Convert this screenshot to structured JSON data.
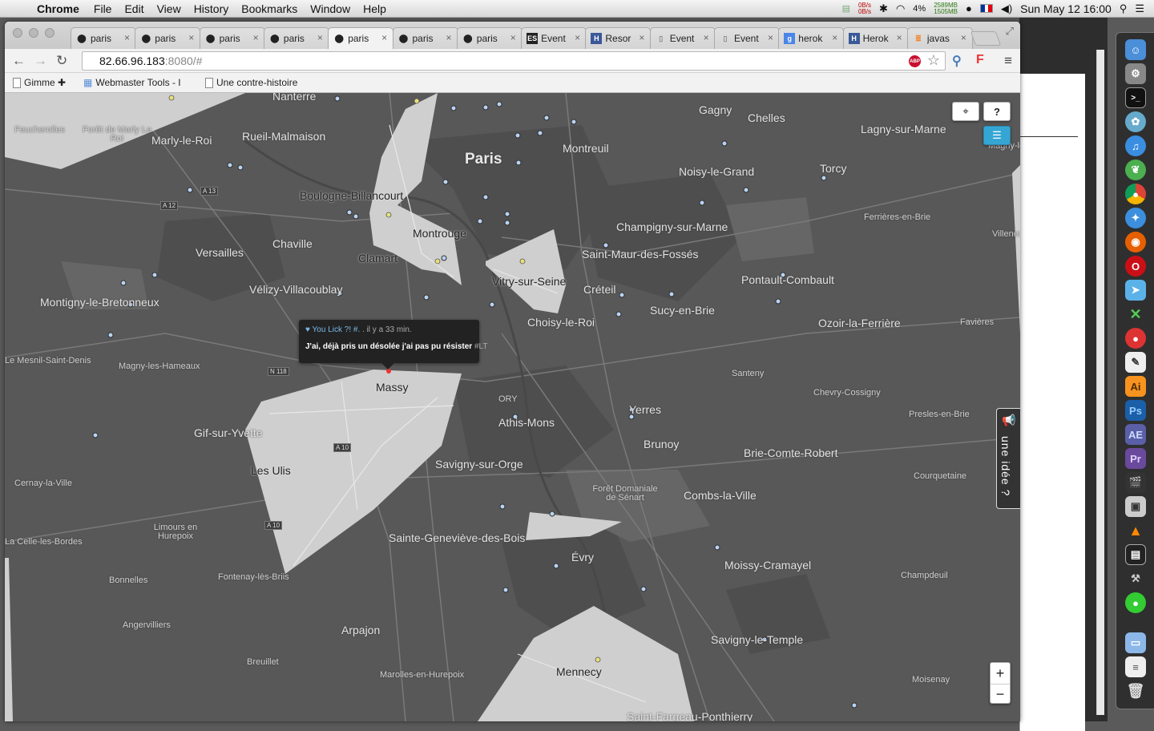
{
  "menubar": {
    "app_name": "Chrome",
    "menus": [
      "File",
      "Edit",
      "View",
      "History",
      "Bookmarks",
      "Window",
      "Help"
    ],
    "net_up": "0B/s",
    "net_down": "0B/s",
    "battery": "4%",
    "mem_used": "2589MB",
    "mem_free": "1505MB",
    "datetime": "Sun May 12  16:00"
  },
  "tabs": [
    {
      "label": "paris",
      "icon": "map-pin-icon"
    },
    {
      "label": "paris",
      "icon": "map-pin-icon"
    },
    {
      "label": "paris",
      "icon": "map-pin-icon"
    },
    {
      "label": "paris",
      "icon": "map-pin-icon"
    },
    {
      "label": "paris",
      "icon": "map-pin-icon",
      "active": true
    },
    {
      "label": "paris",
      "icon": "map-pin-icon"
    },
    {
      "label": "paris",
      "icon": "map-pin-icon"
    },
    {
      "label": "Event",
      "icon": "es-icon"
    },
    {
      "label": "Resor",
      "icon": "h-icon"
    },
    {
      "label": "Event",
      "icon": "page-icon"
    },
    {
      "label": "Event",
      "icon": "page-icon"
    },
    {
      "label": "herok",
      "icon": "google-icon"
    },
    {
      "label": "Herok",
      "icon": "h-icon"
    },
    {
      "label": "javas",
      "icon": "stack-icon"
    }
  ],
  "address": {
    "host": "82.66.96.183",
    "path": ":8080/#"
  },
  "bookmarks": [
    {
      "label": "Gimme ✚"
    },
    {
      "label": "Webmaster Tools - I"
    },
    {
      "label": "Une contre-histoire"
    }
  ],
  "map": {
    "places_big": [
      {
        "name": "Paris"
      }
    ],
    "places": [
      "Nanterre",
      "Rueil-Malmaison",
      "Marly-le-Roi",
      "Boulogne-Billancourt",
      "Montrouge",
      "Clamart",
      "Chaville",
      "Versailles",
      "Vélizy-Villacoublay",
      "Montigny-le-Bretonneux",
      "Vitry-sur-Seine",
      "Créteil",
      "Choisy-le-Roi",
      "Saint-Maur-des-Fossés",
      "Champigny-sur-Marne",
      "Noisy-le-Grand",
      "Montreuil",
      "Gagny",
      "Chelles",
      "Lagny-sur-Marne",
      "Torcy",
      "Pontault-Combault",
      "Sucy-en-Brie",
      "Ozoir-la-Ferrière",
      "Massy",
      "Athis-Mons",
      "Yerres",
      "Brunoy",
      "Brie-Comte-Robert",
      "Gif-sur-Yvette",
      "Les Ulis",
      "Savigny-sur-Orge",
      "Combs-la-Ville",
      "Sainte-Geneviève-des-Bois",
      "Évry",
      "Moissy-Cramayel",
      "Arpajon",
      "Mennecy",
      "Savigny-le-Temple",
      "Saint-Fargeau-Ponthierry"
    ],
    "places_small": [
      "Feucherolles",
      "Forêt de Marly Le Roi",
      "Magny-les-Hameaux",
      "Le Mesnil-Saint-Denis",
      "Cernay-la-Ville",
      "Limours en Hurepoix",
      "Bonnelles",
      "Fontenay-lès-Briis",
      "Angervilliers",
      "Breuillet",
      "Marolles-en-Hurepoix",
      "Santeny",
      "Chevry-Cossigny",
      "Presles-en-Brie",
      "Courquetaine",
      "Forêt Domaniale de Sénart",
      "Champdeuil",
      "Moisenay",
      "Favières",
      "Ferrières-en-Brie",
      "ORY",
      "La Celle-les-Bordes",
      "Magny-le-Hongre",
      "Villeneuve"
    ],
    "roads": [
      "A 13",
      "A 12",
      "N 118",
      "A 10",
      "A 10"
    ],
    "popup": {
      "author": "You Lick ?! #.",
      "time": ". il y a 33 min.",
      "message": "J'ai, déjà pris un désolée j'ai pas pu résister ",
      "tag": "#LT"
    },
    "idea_label": "une idée ?",
    "zoom_in": "+",
    "zoom_out": "−"
  },
  "colors": {
    "map_bg": "#585858",
    "zone_fill": "#cfcfcf",
    "accent": "#35a6d4",
    "point": "#b9d3f2"
  }
}
